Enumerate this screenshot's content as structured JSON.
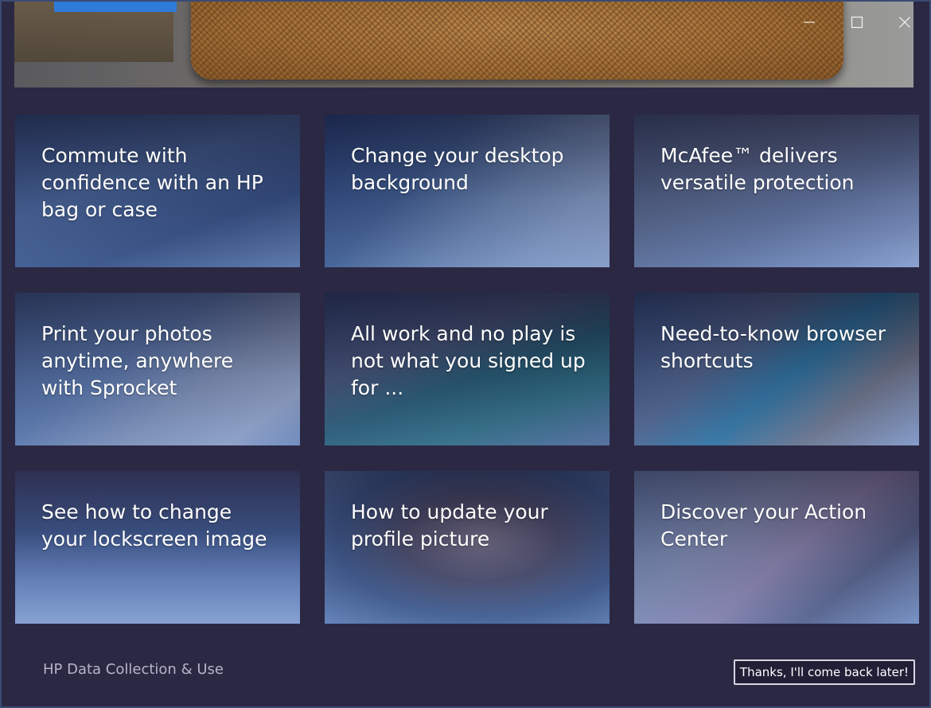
{
  "window": {
    "controls": {
      "minimize_icon": "minimize-icon",
      "maximize_icon": "maximize-icon",
      "close_icon": "close-icon"
    }
  },
  "tiles": [
    {
      "title": "Commute with confidence with an HP bag or case"
    },
    {
      "title": "Change your desktop background"
    },
    {
      "title": "McAfee™ delivers versatile protection"
    },
    {
      "title": "Print your photos anytime, anywhere with Sprocket"
    },
    {
      "title": "All work and no play is not what you signed up for ..."
    },
    {
      "title": "Need-to-know browser shortcuts"
    },
    {
      "title": "See how to change your lockscreen image"
    },
    {
      "title": "How to update your profile picture"
    },
    {
      "title": "Discover your Action Center"
    }
  ],
  "footer": {
    "data_link": "HP Data Collection & Use",
    "later_button": "Thanks, I'll come back later!"
  },
  "colors": {
    "background": "#2b2844",
    "accent": "#2f7bd9",
    "tile_overlay": "#2a4690"
  }
}
